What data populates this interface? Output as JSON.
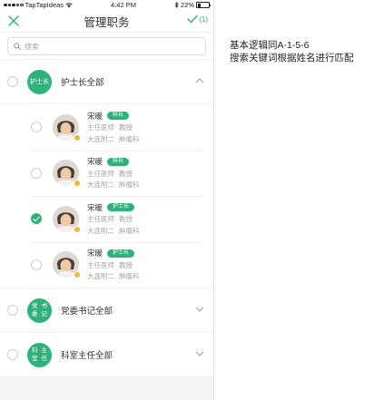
{
  "status_bar": {
    "carrier": "TapTapIdeas",
    "time": "4:42 PM",
    "battery": "22%"
  },
  "nav": {
    "title": "管理职务",
    "confirm_count": "(1)"
  },
  "search": {
    "placeholder": "搜索"
  },
  "groups": [
    {
      "badge": "护士长",
      "title": "护士长全部",
      "expanded": true,
      "members": [
        {
          "name": "宋暖",
          "tag": "科长",
          "title": "主任医师",
          "rank": "教授",
          "hospital": "大连附二",
          "dept": "肿瘤科",
          "checked": false
        },
        {
          "name": "宋暖",
          "tag": "科长",
          "title": "主任医师",
          "rank": "教授",
          "hospital": "大连附二",
          "dept": "肿瘤科",
          "checked": false
        },
        {
          "name": "宋暖",
          "tag": "护士长",
          "title": "主任医师",
          "rank": "教授",
          "hospital": "大连附二",
          "dept": "肿瘤科",
          "checked": true
        },
        {
          "name": "宋暖",
          "tag": "护士长",
          "title": "主任医师",
          "rank": "教授",
          "hospital": "大连附二",
          "dept": "肿瘤科",
          "checked": false
        }
      ]
    },
    {
      "badge_line1": "党委",
      "badge_line2": "书记",
      "title": "党委书记全部",
      "expanded": false
    },
    {
      "badge_line1": "科室",
      "badge_line2": "主任",
      "title": "科室主任全部",
      "expanded": false
    }
  ],
  "note": {
    "line1": "基本逻辑同A-1-5-6",
    "line2": "搜索关键词根据姓名进行匹配"
  },
  "colors": {
    "accent": "#2db37a",
    "medal": "#f5b53c",
    "divider": "#eeeeee"
  }
}
